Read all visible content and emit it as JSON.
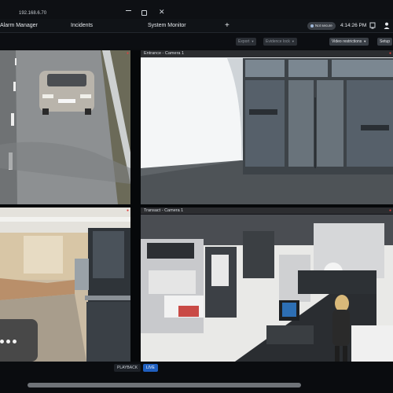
{
  "window": {
    "address": "192.168.6.70",
    "minimize_icon": "minimize-icon",
    "maximize_icon": "maximize-icon",
    "close_icon": "close-icon",
    "close_glyph": "✕"
  },
  "tabs": [
    {
      "label": "Alarm Manager"
    },
    {
      "label": "Incidents"
    },
    {
      "label": "System Monitor"
    }
  ],
  "add_tab_label": "+",
  "status": {
    "secure_label": "Not secure",
    "time": "4:14:26 PM"
  },
  "toolbar": {
    "export_label": "Export",
    "evidence_lock_label": "Evidence lock",
    "video_restrictions_label": "Video restrictions",
    "setup_label": "Setup"
  },
  "tiles": [
    {
      "title": ""
    },
    {
      "title": "Entrance - Camera 1"
    },
    {
      "title": ""
    },
    {
      "title": "Transact - Camera 1"
    }
  ],
  "modes": {
    "playback": "PLAYBACK",
    "live": "LIVE"
  },
  "colors": {
    "accent": "#1f5fbf",
    "record": "#e04040",
    "background": "#0b0d10"
  }
}
